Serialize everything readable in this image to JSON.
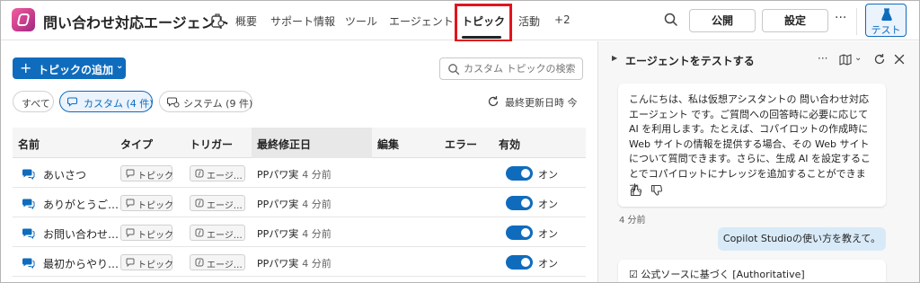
{
  "app": {
    "title": "問い合わせ対応エージェント"
  },
  "nav": {
    "tabs": [
      {
        "label": "概要"
      },
      {
        "label": "サポート情報"
      },
      {
        "label": "ツール"
      },
      {
        "label": "エージェント"
      },
      {
        "label": "トピック",
        "active": true
      },
      {
        "label": "活動"
      },
      {
        "label": "+2"
      }
    ]
  },
  "actions": {
    "publish_label": "公開",
    "settings_label": "設定",
    "more_label": "···",
    "test_label": "テスト"
  },
  "toolbar": {
    "add_topic_label": "トピックの追加",
    "search_placeholder": "カスタム トピックの検索"
  },
  "filters": [
    {
      "label": "すべて",
      "selected": false
    },
    {
      "label": "カスタム (4 件)",
      "selected": true
    },
    {
      "label": "システム (9 件)",
      "selected": false
    }
  ],
  "refresh_label": "最終更新日時 今",
  "table": {
    "columns": [
      "名前",
      "タイプ",
      "トリガー",
      "最終修正日",
      "編集",
      "エラー",
      "有効"
    ],
    "rows": [
      {
        "name": "あいさつ",
        "type": "トピック",
        "trigger": "エージ…",
        "modified_by": "PPパワ実",
        "modified_ago": "4 分前",
        "enabled": "オン"
      },
      {
        "name": "ありがとうご…",
        "type": "トピック",
        "trigger": "エージ…",
        "modified_by": "PPパワ実",
        "modified_ago": "4 分前",
        "enabled": "オン"
      },
      {
        "name": "お問い合わせ…",
        "type": "トピック",
        "trigger": "エージ…",
        "modified_by": "PPパワ実",
        "modified_ago": "4 分前",
        "enabled": "オン"
      },
      {
        "name": "最初からやり…",
        "type": "トピック",
        "trigger": "エージ…",
        "modified_by": "PPパワ実",
        "modified_ago": "4 分前",
        "enabled": "オン"
      }
    ]
  },
  "test_pane": {
    "title": "エージェントをテストする",
    "bot_message": "こんにちは、私は仮想アシスタントの 問い合わせ対応エージェント です。ご質問への回答時に必要に応じて AI を利用します。たとえば、コパイロットの作成時に Web サイトの情報を提供する場合、その Web サイトについて質問できます。さらに、生成 AI を設定することでコパイロットにナレッジを追加することができます。",
    "timestamp": "4 分前",
    "user_message": "Copilot Studioの使い方を教えて。",
    "next_message": "☑ 公式ソースに基づく [Authoritative]"
  },
  "colors": {
    "accent": "#0f6cbd",
    "highlight_box": "#e0151f",
    "user_bubble": "#d8eaf8"
  }
}
